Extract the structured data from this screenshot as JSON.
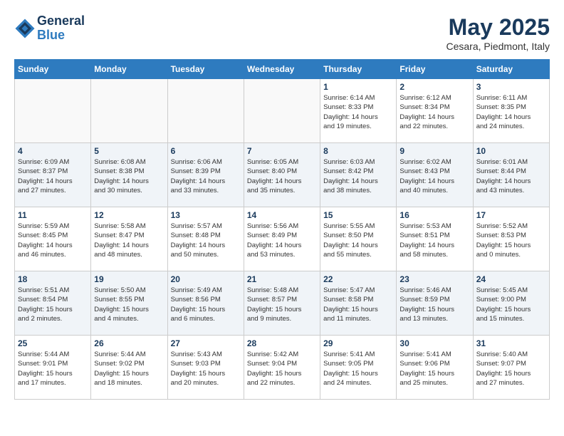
{
  "header": {
    "logo_line1": "General",
    "logo_line2": "Blue",
    "month": "May 2025",
    "location": "Cesara, Piedmont, Italy"
  },
  "weekdays": [
    "Sunday",
    "Monday",
    "Tuesday",
    "Wednesday",
    "Thursday",
    "Friday",
    "Saturday"
  ],
  "weeks": [
    [
      {
        "day": "",
        "info": ""
      },
      {
        "day": "",
        "info": ""
      },
      {
        "day": "",
        "info": ""
      },
      {
        "day": "",
        "info": ""
      },
      {
        "day": "1",
        "info": "Sunrise: 6:14 AM\nSunset: 8:33 PM\nDaylight: 14 hours\nand 19 minutes."
      },
      {
        "day": "2",
        "info": "Sunrise: 6:12 AM\nSunset: 8:34 PM\nDaylight: 14 hours\nand 22 minutes."
      },
      {
        "day": "3",
        "info": "Sunrise: 6:11 AM\nSunset: 8:35 PM\nDaylight: 14 hours\nand 24 minutes."
      }
    ],
    [
      {
        "day": "4",
        "info": "Sunrise: 6:09 AM\nSunset: 8:37 PM\nDaylight: 14 hours\nand 27 minutes."
      },
      {
        "day": "5",
        "info": "Sunrise: 6:08 AM\nSunset: 8:38 PM\nDaylight: 14 hours\nand 30 minutes."
      },
      {
        "day": "6",
        "info": "Sunrise: 6:06 AM\nSunset: 8:39 PM\nDaylight: 14 hours\nand 33 minutes."
      },
      {
        "day": "7",
        "info": "Sunrise: 6:05 AM\nSunset: 8:40 PM\nDaylight: 14 hours\nand 35 minutes."
      },
      {
        "day": "8",
        "info": "Sunrise: 6:03 AM\nSunset: 8:42 PM\nDaylight: 14 hours\nand 38 minutes."
      },
      {
        "day": "9",
        "info": "Sunrise: 6:02 AM\nSunset: 8:43 PM\nDaylight: 14 hours\nand 40 minutes."
      },
      {
        "day": "10",
        "info": "Sunrise: 6:01 AM\nSunset: 8:44 PM\nDaylight: 14 hours\nand 43 minutes."
      }
    ],
    [
      {
        "day": "11",
        "info": "Sunrise: 5:59 AM\nSunset: 8:45 PM\nDaylight: 14 hours\nand 46 minutes."
      },
      {
        "day": "12",
        "info": "Sunrise: 5:58 AM\nSunset: 8:47 PM\nDaylight: 14 hours\nand 48 minutes."
      },
      {
        "day": "13",
        "info": "Sunrise: 5:57 AM\nSunset: 8:48 PM\nDaylight: 14 hours\nand 50 minutes."
      },
      {
        "day": "14",
        "info": "Sunrise: 5:56 AM\nSunset: 8:49 PM\nDaylight: 14 hours\nand 53 minutes."
      },
      {
        "day": "15",
        "info": "Sunrise: 5:55 AM\nSunset: 8:50 PM\nDaylight: 14 hours\nand 55 minutes."
      },
      {
        "day": "16",
        "info": "Sunrise: 5:53 AM\nSunset: 8:51 PM\nDaylight: 14 hours\nand 58 minutes."
      },
      {
        "day": "17",
        "info": "Sunrise: 5:52 AM\nSunset: 8:53 PM\nDaylight: 15 hours\nand 0 minutes."
      }
    ],
    [
      {
        "day": "18",
        "info": "Sunrise: 5:51 AM\nSunset: 8:54 PM\nDaylight: 15 hours\nand 2 minutes."
      },
      {
        "day": "19",
        "info": "Sunrise: 5:50 AM\nSunset: 8:55 PM\nDaylight: 15 hours\nand 4 minutes."
      },
      {
        "day": "20",
        "info": "Sunrise: 5:49 AM\nSunset: 8:56 PM\nDaylight: 15 hours\nand 6 minutes."
      },
      {
        "day": "21",
        "info": "Sunrise: 5:48 AM\nSunset: 8:57 PM\nDaylight: 15 hours\nand 9 minutes."
      },
      {
        "day": "22",
        "info": "Sunrise: 5:47 AM\nSunset: 8:58 PM\nDaylight: 15 hours\nand 11 minutes."
      },
      {
        "day": "23",
        "info": "Sunrise: 5:46 AM\nSunset: 8:59 PM\nDaylight: 15 hours\nand 13 minutes."
      },
      {
        "day": "24",
        "info": "Sunrise: 5:45 AM\nSunset: 9:00 PM\nDaylight: 15 hours\nand 15 minutes."
      }
    ],
    [
      {
        "day": "25",
        "info": "Sunrise: 5:44 AM\nSunset: 9:01 PM\nDaylight: 15 hours\nand 17 minutes."
      },
      {
        "day": "26",
        "info": "Sunrise: 5:44 AM\nSunset: 9:02 PM\nDaylight: 15 hours\nand 18 minutes."
      },
      {
        "day": "27",
        "info": "Sunrise: 5:43 AM\nSunset: 9:03 PM\nDaylight: 15 hours\nand 20 minutes."
      },
      {
        "day": "28",
        "info": "Sunrise: 5:42 AM\nSunset: 9:04 PM\nDaylight: 15 hours\nand 22 minutes."
      },
      {
        "day": "29",
        "info": "Sunrise: 5:41 AM\nSunset: 9:05 PM\nDaylight: 15 hours\nand 24 minutes."
      },
      {
        "day": "30",
        "info": "Sunrise: 5:41 AM\nSunset: 9:06 PM\nDaylight: 15 hours\nand 25 minutes."
      },
      {
        "day": "31",
        "info": "Sunrise: 5:40 AM\nSunset: 9:07 PM\nDaylight: 15 hours\nand 27 minutes."
      }
    ]
  ]
}
